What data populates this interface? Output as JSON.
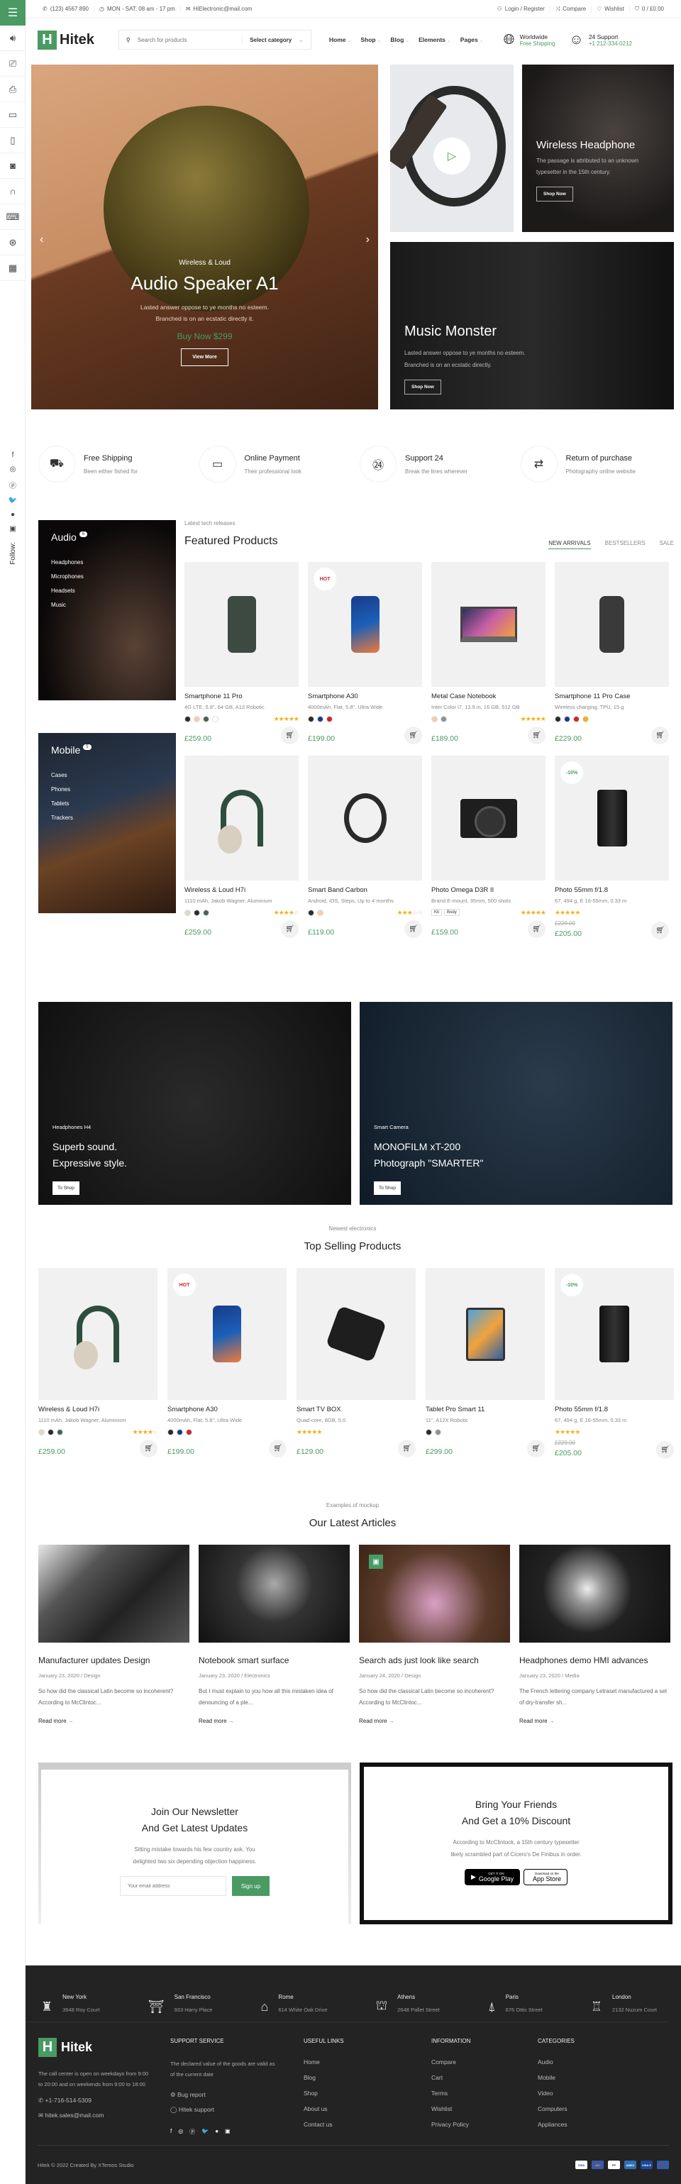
{
  "brand": {
    "name": "Hitek",
    "logo_letter": "H",
    "accent": "#4a9a63",
    "sale_color": "#d0242b"
  },
  "topbar": {
    "phone": "(123) 4567 890",
    "hours": "MON - SAT: 08 am - 17 pm",
    "email": "HiElectronic@mail.com",
    "login": "Login / Register",
    "compare": "Compare",
    "wishlist": "Wishlist",
    "cart": "0 / £0.00"
  },
  "header": {
    "search_placeholder": "Search for products",
    "category_select": "Select category",
    "nav": [
      "Home",
      "Shop",
      "Blog",
      "Elements",
      "Pages"
    ],
    "promo_shipping": {
      "title": "Worldwide",
      "subtitle": "Free Shipping"
    },
    "promo_support": {
      "title": "24 Support",
      "subtitle": "+1 212-334-0212"
    }
  },
  "sidebar": {
    "menu_icon": "hamburger-icon",
    "categories": [
      "speaker-icon",
      "camcorder-icon",
      "camera-icon",
      "monitor-icon",
      "phone-icon",
      "washer-icon",
      "headphones-icon",
      "laptop-icon",
      "gamepad-icon",
      "calculator-icon"
    ],
    "follow_label": "Follow:",
    "social": [
      "facebook-icon",
      "instagram-icon",
      "pinterest-icon",
      "twitter-icon",
      "whatsapp-icon",
      "youtube-icon"
    ]
  },
  "hero": {
    "kicker": "Wireless & Loud",
    "title": "Audio Speaker A1",
    "text_line1": "Lasted answer oppose to ye months no esteem.",
    "text_line2": "Branched is on an ecstatic directly it.",
    "price": "Buy Now $299",
    "button": "View More"
  },
  "tiles": {
    "headphone": {
      "title": "Wireless Headphone",
      "text": "The passage is attributed to an unknown typesetter in the 15th century.",
      "button": "Shop Now"
    },
    "music": {
      "title": "Music Monster",
      "text_line1": "Lasted answer oppose to ye months no esteem.",
      "text_line2": "Branched is on an ecstatic directly.",
      "button": "Shop Now"
    }
  },
  "features": [
    {
      "title": "Free Shipping",
      "text": "Been either fished for",
      "icon": "truck-icon"
    },
    {
      "title": "Online Payment",
      "text": "Their professional look",
      "icon": "card-icon"
    },
    {
      "title": "Support 24",
      "text": "Break the lines wherever",
      "icon": "support-24-icon"
    },
    {
      "title": "Return of purchase",
      "text": "Photography online website",
      "icon": "return-icon"
    }
  ],
  "category_cards": [
    {
      "title": "Audio",
      "count": "6",
      "items": [
        "Headphones",
        "Microphones",
        "Headsets",
        "Music"
      ]
    },
    {
      "title": "Mobile",
      "count": "5",
      "items": [
        "Cases",
        "Phones",
        "Tablets",
        "Trackers"
      ]
    }
  ],
  "featured": {
    "kicker": "Latest tech releases",
    "title": "Featured Products",
    "tabs": [
      "NEW ARRIVALS",
      "BESTSELLERS",
      "SALE"
    ],
    "products": [
      {
        "name": "Smartphone 11 Pro",
        "desc": "4G LTE, 5.8\", 64 GB, A13 Robotic",
        "price": "£259.00",
        "rating": 5,
        "swatches": [
          "#2b2b2b",
          "#f1cdb3",
          "#4e5e58",
          "#ffffff"
        ],
        "shape": "phone"
      },
      {
        "name": "Smartphone A30",
        "desc": "4000mAh, Flat, 5.8\", Ultra Wide",
        "price": "£199.00",
        "rating": 0,
        "label": "HOT",
        "swatches": [
          "#2b2b2b",
          "#183a8a",
          "#d0242b"
        ],
        "shape": "phone blue"
      },
      {
        "name": "Metal Case Notebook",
        "desc": "Inter Color i7, 13.9 in, 16 GB, 512 GB",
        "price": "£189.00",
        "rating": 5,
        "swatches": [
          "#f1cdb3",
          "#8a9199"
        ],
        "shape": "laptop"
      },
      {
        "name": "Smartphone 11 Pro Case",
        "desc": "Wireless charging, TPU, 15 g",
        "price": "£229.00",
        "rating": 0,
        "swatches": [
          "#2b2b2b",
          "#183a8a",
          "#d0242b",
          "#f2b01e"
        ],
        "shape": "case"
      },
      {
        "name": "Wireless & Loud H7i",
        "desc": "1110 mAh, Jakob Wagner, Aluminium",
        "price": "£259.00",
        "rating": 4,
        "swatches": [
          "#e3d8c6",
          "#2b2b2b",
          "#4e5e58"
        ],
        "shape": "head"
      },
      {
        "name": "Smart Band Carbon",
        "desc": "Android, iOS, Steps, Up to 4 months",
        "price": "£119.00",
        "rating": 3,
        "swatches": [
          "#2b2b2b",
          "#f1cdb3"
        ],
        "shape": "band"
      },
      {
        "name": "Photo Omega D3R II",
        "desc": "Brand E-mount, 35mm, 500 shots",
        "price": "£159.00",
        "rating": 5,
        "chips": [
          "Kit",
          "Body"
        ],
        "shape": "cam"
      },
      {
        "name": "Photo 55mm f/1.8",
        "desc": "67, 494 g, E 16-55mm, 0.33 m",
        "price": "£205.00",
        "old_price": "£229.00",
        "rating": 5,
        "label": "-10%",
        "shape": "lens"
      }
    ]
  },
  "banners": [
    {
      "kicker": "Headphones H4",
      "title_line1": "Superb sound.",
      "title_line2": "Expressive style.",
      "button": "To Shop"
    },
    {
      "kicker": "Smart Camera",
      "title_line1": "MONOFILM xT-200",
      "title_line2": "Photograph \"SMARTER\"",
      "button": "To Shop"
    }
  ],
  "top_selling": {
    "kicker": "Newest electronics",
    "title": "Top Selling Products",
    "products": [
      {
        "name": "Wireless & Loud H7i",
        "desc": "1110 mAh, Jakob Wagner, Aluminium",
        "price": "£259.00",
        "rating": 4,
        "swatches": [
          "#e3d8c6",
          "#2b2b2b",
          "#4e5e58"
        ],
        "shape": "head"
      },
      {
        "name": "Smartphone A30",
        "desc": "4000mAh, Flat, 5.8\", Ultra Wide",
        "price": "£199.00",
        "rating": 0,
        "label": "HOT",
        "swatches": [
          "#2b2b2b",
          "#183a8a",
          "#d0242b"
        ],
        "shape": "phone blue"
      },
      {
        "name": "Smart TV BOX",
        "desc": "Quad-core, 8GB, 5.0",
        "price": "£129.00",
        "rating": 5,
        "shape": "box"
      },
      {
        "name": "Tablet Pro Smart 11",
        "desc": "11\", A12X Robotic",
        "price": "£299.00",
        "rating": 0,
        "swatches": [
          "#2b2b2b",
          "#8a9199"
        ],
        "shape": "tablet"
      },
      {
        "name": "Photo 55mm f/1.8",
        "desc": "67, 494 g, E 16-55mm, 0.33 m",
        "price": "£205.00",
        "old_price": "£229.00",
        "rating": 5,
        "label": "-10%",
        "shape": "lens"
      }
    ]
  },
  "articles": {
    "kicker": "Examples of mockup",
    "title": "Our Latest Articles",
    "read_more": "Read more",
    "items": [
      {
        "title": "Manufacturer updates Design",
        "date": "January 23, 2020",
        "category": "Design",
        "excerpt": "So how did the classical Latin become so incoherent? According to McClintoc...",
        "bg": "linear-gradient(135deg,#e8e8e8 0%,#555 30%,#222 60%,#555)"
      },
      {
        "title": "Notebook smart surface",
        "date": "January 23, 2020",
        "category": "Electronics",
        "excerpt": "But I must explain to you how all this mistaken idea of denouncing of a ple...",
        "bg": "radial-gradient(circle at 50% 40%,#aaa,#333 40%,#111)"
      },
      {
        "title": "Search ads just look like search",
        "date": "January 24, 2020",
        "category": "Design",
        "excerpt": "So how did the classical Latin become so incoherent? According to McClintoc...",
        "bg": "radial-gradient(circle at 50% 60%,#d9a0c4,#5a3a2a 55%,#3a2416)",
        "gallery": true
      },
      {
        "title": "Headphones demo HMI advances",
        "date": "January 23, 2020",
        "category": "Media",
        "excerpt": "The French lettering company Letraset manufactured a set of dry-transfer sh...",
        "bg": "radial-gradient(circle at 45% 45%,#eee,#999 15%,#222 45%,#111)"
      }
    ]
  },
  "newsletter": {
    "title_line1": "Join Our Newsletter",
    "title_line2": "And Get Latest Updates",
    "text_line1": "Sitting mistake towards his few country ask. You",
    "text_line2": "delighted two six depending objection happiness.",
    "email_placeholder": "Your email address",
    "button": "Sign up"
  },
  "referral": {
    "title_line1": "Bring Your Friends",
    "title_line2": "And Get a 10% Discount",
    "text_line1": "According to McClintock, a 15th century typesetter",
    "text_line2": "likely scrambled part of Cicero's De Finibus in order.",
    "google_small": "GET IT ON",
    "google": "Google Play",
    "apple_small": "Download on the",
    "apple": "App Store"
  },
  "footer": {
    "cities": [
      {
        "name": "New York",
        "address": "3948 Roy Court",
        "icon": "statue-of-liberty-icon"
      },
      {
        "name": "San Francisco",
        "address": "933 Harry Place",
        "icon": "golden-gate-icon"
      },
      {
        "name": "Rome",
        "address": "614 White Oak Drive",
        "icon": "colosseum-icon"
      },
      {
        "name": "Athens",
        "address": "2648 Pallet Street",
        "icon": "parthenon-icon"
      },
      {
        "name": "Paris",
        "address": "676 Ottis Street",
        "icon": "eiffel-tower-icon"
      },
      {
        "name": "London",
        "address": "2132 Nuzum Court",
        "icon": "big-ben-icon"
      }
    ],
    "about": "The call center is open on weekdays from 9:00 to 20:00 and on weekends from 9:00 to 18:00",
    "phone": "+1-716-514-5309",
    "email": "hitek.sales@mail.com",
    "support": {
      "heading": "SUPPORT SERVICE",
      "text": "The declared value of the goods are valid as of the current date",
      "bug": "Bug report",
      "help": "Hitek support"
    },
    "useful": {
      "heading": "USEFUL LINKS",
      "items": [
        "Home",
        "Blog",
        "Shop",
        "About us",
        "Contact us"
      ]
    },
    "information": {
      "heading": "INFORMATION",
      "items": [
        "Compare",
        "Cart",
        "Terms",
        "Wishlist",
        "Privacy Policy"
      ]
    },
    "categories": {
      "heading": "CATEGORIES",
      "items": [
        "Audio",
        "Mobile",
        "Video",
        "Computers",
        "Appliances"
      ]
    },
    "copyright": "Hitek © 2022 Created By XTemos Studio",
    "payments": [
      {
        "name": "VISA",
        "color": "#ffffff",
        "text": "#1a3a8a"
      },
      {
        "name": "MC",
        "color": "#3a5aa8",
        "text": "#f2a23a"
      },
      {
        "name": "PP",
        "color": "#ffffff",
        "text": "#1a3a8a"
      },
      {
        "name": "AMEX",
        "color": "#2f6fb8",
        "text": "#ffffff"
      },
      {
        "name": "VISA E",
        "color": "#1a4a9a",
        "text": "#ffffff"
      },
      {
        "name": "MAE",
        "color": "#2f5fa8",
        "text": "#d0242b"
      }
    ]
  }
}
